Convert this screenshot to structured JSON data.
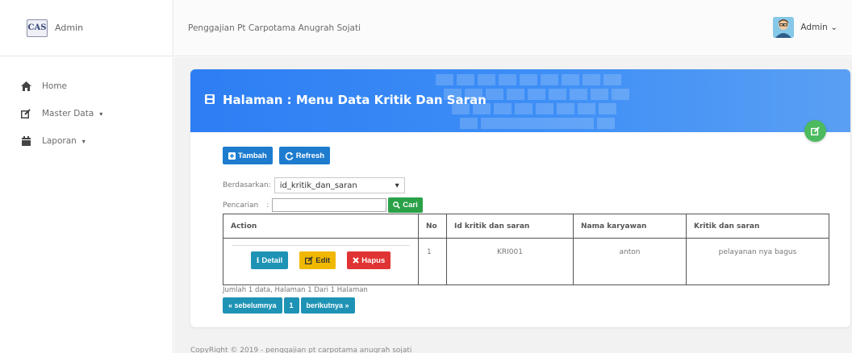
{
  "brand": {
    "logo_text": "CAS",
    "name": "Admin"
  },
  "sidebar": {
    "items": [
      {
        "label": "Home",
        "icon": "home-icon"
      },
      {
        "label": "Master Data",
        "icon": "edit-icon",
        "caret": "▾"
      },
      {
        "label": "Laporan",
        "icon": "calendar-icon",
        "caret": "▾"
      }
    ]
  },
  "header": {
    "title": "Penggajian Pt Carpotama Anugrah Sojati",
    "user": "Admin",
    "user_caret": "⌄"
  },
  "page": {
    "title": "Halaman : Menu Data Kritik Dan Saran"
  },
  "toolbar": {
    "add_label": "Tambah",
    "refresh_label": "Refresh"
  },
  "filter": {
    "label": "Berdasarkan:",
    "selected": "id_kritik_dan_saran",
    "search_label": "Pencarian",
    "search_sep": ":",
    "search_value": "",
    "search_button": "Cari"
  },
  "table": {
    "headers": [
      "Action",
      "No",
      "Id kritik dan saran",
      "Nama karyawan",
      "Kritik dan saran"
    ],
    "rows": [
      {
        "no": "1",
        "id": "KRI001",
        "nama": "anton",
        "kritik": "pelayanan nya bagus"
      }
    ],
    "actions": {
      "detail": "Detail",
      "edit": "Edit",
      "delete": "Hapus"
    }
  },
  "summary": "Jumlah 1 data, Halaman 1 Dari 1 Halaman",
  "pager": {
    "prev": "« sebelumnya",
    "page": "1",
    "next": "berikutnya »"
  },
  "footer": "CopyRight © 2019 - penggajian pt carpotama anugrah sojati",
  "colors": {
    "primary": "#2d7ef3",
    "success": "#2aa148",
    "info": "#1e93b5",
    "warning": "#f0b800",
    "danger": "#e03333"
  }
}
